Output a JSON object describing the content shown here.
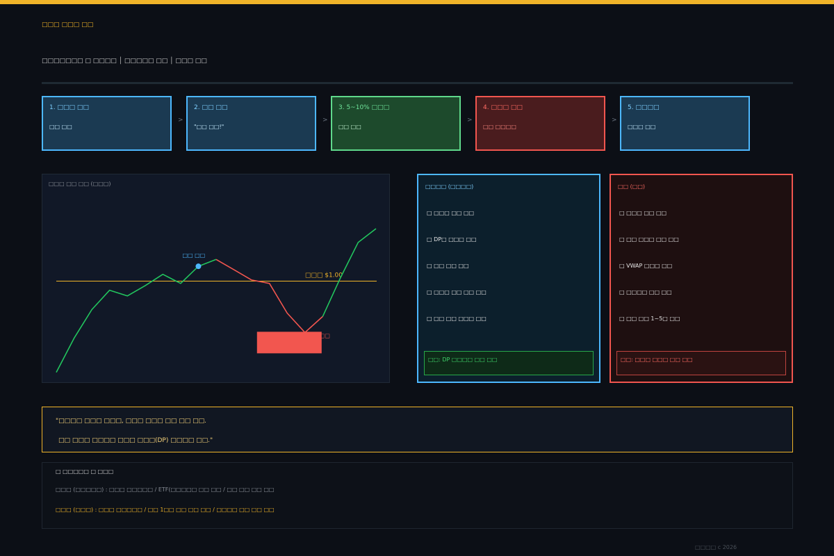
{
  "header": {
    "title": "□□□ □□□ □□",
    "subtitle": "□□□□□□□ □ □□□□ │ □□□□□ □□ │ □□□ □□"
  },
  "steps": [
    {
      "label": "1. □□□ □□",
      "sub": "□□ □□",
      "tone": "blue"
    },
    {
      "label": "2. □□ □□",
      "sub": "\"□□ □□!\"",
      "tone": "blue"
    },
    {
      "label": "3. 5~10% □□□",
      "sub": "□□ □□",
      "tone": "green"
    },
    {
      "label": "4. □□□ □□",
      "sub": "□□ □□□□",
      "tone": "red"
    },
    {
      "label": "5. □□□□",
      "sub": "□□□ □□",
      "tone": "blue"
    }
  ],
  "step_arrow": ">",
  "chart_data": {
    "type": "line",
    "title": "□□□ □□ □□ (□□□)",
    "x": [
      0,
      1,
      2,
      3,
      4,
      5,
      6,
      7,
      8,
      9,
      10,
      11,
      12,
      13,
      14,
      15,
      16,
      17,
      18
    ],
    "y": [
      1.053,
      1.056,
      1.0585,
      1.0602,
      1.0597,
      1.0606,
      1.0616,
      1.0608,
      1.0623,
      1.0629,
      1.062,
      1.0611,
      1.0608,
      1.0582,
      1.0565,
      1.0579,
      1.0613,
      1.0644,
      1.0656
    ],
    "segments": [
      {
        "from": 0,
        "to": 9,
        "color": "#22c55e"
      },
      {
        "from": 9,
        "to": 15,
        "color": "#f2564f"
      },
      {
        "from": 15,
        "to": 18,
        "color": "#22c55e"
      }
    ],
    "reference_line": {
      "value": 1.061,
      "label": "□□□ $1.00",
      "color": "#f0b429"
    },
    "peak_marker": {
      "index": 8,
      "label": "□□ □□",
      "color": "#4db8ff"
    },
    "drop_label": "□□",
    "drop_color": "#f2564f"
  },
  "positive_box": {
    "title": "□□□□ (□□□□)",
    "items": [
      "□ □□□ □□ □□",
      "□ DP□ □□□ □□",
      "□ □□ □□ □□",
      "□ □□□ □□ □□ □□",
      "□ □□ □□ □□□ □□"
    ],
    "note": "□□: DP □□□□ □□ □□"
  },
  "negative_box": {
    "title": "□□ (□□)",
    "items": [
      "□ □□□ □□ □□",
      "□ □□ □□□ □□ □□",
      "□ VWAP □□□ □□",
      "□ □□□□ □□ □□",
      "□ □□ □□ 1~5□ □□"
    ],
    "note": "□□: □□□ □□□ □□ □□"
  },
  "quote": {
    "line1": "\"□□□□ □□□ □□□, □□□ □□□ □□ □□ □□.",
    "line2": "□□ □□□ □□□□ □□□ □□□(DP) □□□□ □□.\""
  },
  "info": {
    "heading": "□ □□□□□ □ □□□",
    "line1": "□□□ (□□□□□) : □□□ □□□□□ / ETF(□□□□□ □□ □□ / □□ □□ □□ □□",
    "line2": "□□□ (□□□) : □□□ □□□□□ / □□ 1□□ □□ □□ □□ / □□□□ □□ □□ □□"
  },
  "footer": "□□□□ c 2026"
}
